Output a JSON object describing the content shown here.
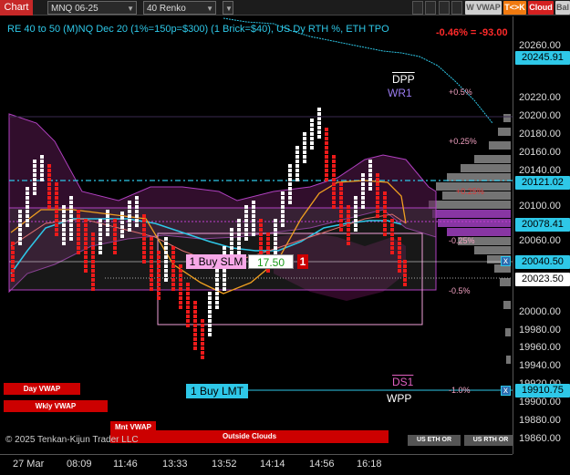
{
  "toolbar": {
    "chart_tab": "Chart",
    "instrument": "MNQ 06-25",
    "bar_type": "40 Renko",
    "w_vwap": "W VWAP",
    "t_k": "T<>K",
    "cloud": "Cloud",
    "bal": "Bal"
  },
  "overlay": {
    "title": "RE 40 to 50 (M)NQ Dec 20 (1%=150p=$300) (1 Brick=$40), US Dy RTH %, ETH TPO",
    "pct_readout": "-0.46% = -93.00",
    "dpp": "DPP",
    "wr1": "WR1",
    "ds1": "DS1",
    "wpp": "WPP",
    "pct_labels": [
      "+0.5%",
      "+0.25%",
      "+0.25%",
      "-0.25%",
      "-0.5%",
      "-1.0%"
    ],
    "copyright": "© 2025 Tenkan-Kijun Trader LLC"
  },
  "orders": {
    "slm_label": "1 Buy SLM",
    "slm_price": "17.50",
    "slm_qty": "1",
    "lmt_label": "1 Buy LMT",
    "close_icon": "x"
  },
  "buttons": {
    "day_vwap": "Day VWAP",
    "wkly_vwap": "Wkly VWAP",
    "mnt_vwap": "Mnt VWAP",
    "outside_clouds": "Outside Clouds",
    "us_eth_or": "US ETH OR",
    "us_rth_or": "US RTH OR"
  },
  "price_axis": {
    "ticks": [
      "20260.00",
      "20220.00",
      "20200.00",
      "20180.00",
      "20160.00",
      "20140.00",
      "20100.00",
      "20080.00",
      "20060.00",
      "20000.00",
      "19980.00",
      "19960.00",
      "19940.00",
      "19920.00",
      "19900.00",
      "19880.00",
      "19860.00"
    ],
    "labels": {
      "top": "20245.91",
      "upper": "20121.02",
      "mid": "20078.41",
      "buy_slm": "20040.50",
      "last": "20023.50",
      "buy_lmt": "19910.75"
    }
  },
  "time_axis": [
    "27 Mar",
    "08:09",
    "11:46",
    "13:33",
    "13:52",
    "14:14",
    "14:56",
    "16:18"
  ],
  "colors": {
    "cyan": "#2ec8e8",
    "magenta": "#b040c0",
    "orange": "#f0a020",
    "red": "#e01818",
    "white": "#ffffff"
  }
}
